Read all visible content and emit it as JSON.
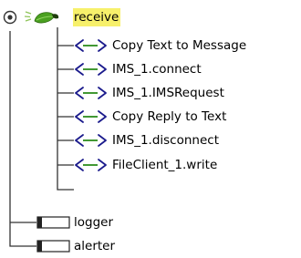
{
  "tree": {
    "root": {
      "label": "receive",
      "expanded": true,
      "selected": true,
      "icon": "receive-operation-icon",
      "highlight_color": "#f7f06b"
    },
    "operations": [
      {
        "label": "Copy Text to Message",
        "icon": "operation-arrows-icon"
      },
      {
        "label": "IMS_1.connect",
        "icon": "operation-arrows-icon"
      },
      {
        "label": "IMS_1.IMSRequest",
        "icon": "operation-arrows-icon"
      },
      {
        "label": "Copy Reply to Text",
        "icon": "operation-arrows-icon"
      },
      {
        "label": "IMS_1.disconnect",
        "icon": "operation-arrows-icon"
      },
      {
        "label": "FileClient_1.write",
        "icon": "operation-arrows-icon"
      }
    ],
    "siblings": [
      {
        "label": "logger",
        "icon": "component-box-icon"
      },
      {
        "label": "alerter",
        "icon": "component-box-icon"
      }
    ],
    "colors": {
      "connector_line": "#333333",
      "arrow_icon": "#1a1a8c",
      "leaf_green": "#3a8c1e"
    }
  }
}
